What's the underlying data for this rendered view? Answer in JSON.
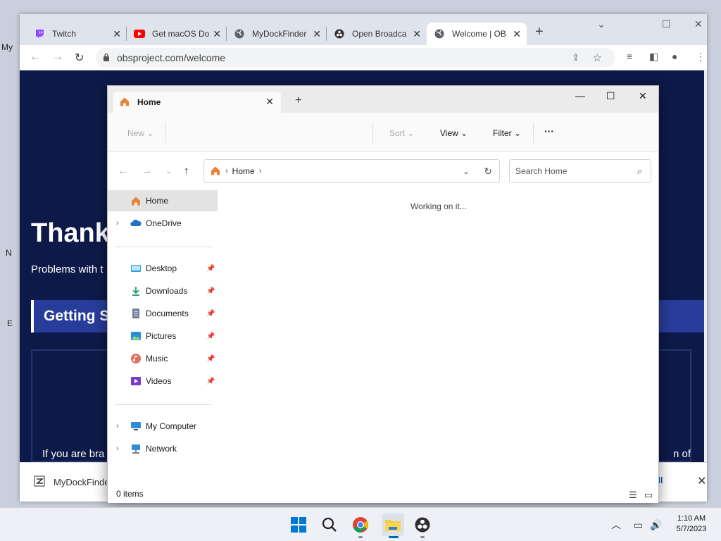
{
  "browser": {
    "tabs": [
      {
        "label": "Twitch",
        "icon": "twitch-icon"
      },
      {
        "label": "Get macOS Do",
        "icon": "youtube-icon"
      },
      {
        "label": "MyDockFinder",
        "icon": "globe-icon"
      },
      {
        "label": "Open Broadca",
        "icon": "obs-icon"
      },
      {
        "label": "Welcome | OB",
        "icon": "globe-icon",
        "active": true
      }
    ],
    "url": "obsproject.com/welcome",
    "page": {
      "heading": "Thank",
      "subtext": "Problems with t",
      "getting_started": "Getting S",
      "body_text": "If you are bra",
      "body_text_right": "n of"
    },
    "download": {
      "file": "MyDockFinde",
      "show_all": "ow all"
    }
  },
  "desktop": {
    "fragments": [
      "My",
      "N",
      "E"
    ]
  },
  "explorer": {
    "tab_title": "Home",
    "commands": {
      "new": "New",
      "sort": "Sort",
      "view": "View",
      "filter": "Filter",
      "more": "···"
    },
    "breadcrumb": "Home",
    "search_placeholder": "Search Home",
    "nav": {
      "home": "Home",
      "onedrive": "OneDrive",
      "desktop": "Desktop",
      "downloads": "Downloads",
      "documents": "Documents",
      "pictures": "Pictures",
      "music": "Music",
      "videos": "Videos",
      "my_computer": "My Computer",
      "network": "Network"
    },
    "status_message": "Working on it...",
    "item_count": "0 items"
  },
  "taskbar": {
    "time": "1:10 AM",
    "date": "5/7/2023"
  },
  "colors": {
    "page_bg": "#0d1a49",
    "banner": "#283c9a",
    "accent": "#0067c0"
  }
}
